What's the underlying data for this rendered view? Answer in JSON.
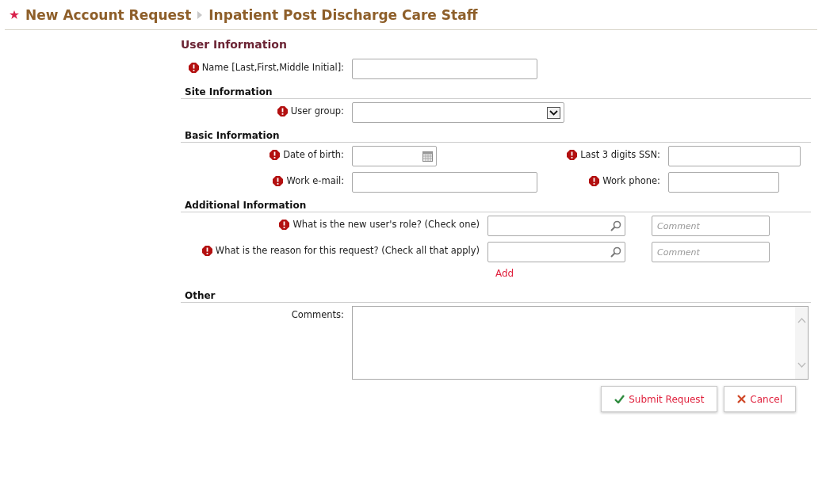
{
  "breadcrumb": [
    "New Account Request",
    "Inpatient Post Discharge Care Staff"
  ],
  "sections": [
    {
      "title": "User Information",
      "kind": "primary",
      "rows": [
        [
          {
            "label": "Name [Last,First,Middle Initial]:",
            "required": true,
            "kind": "text"
          }
        ]
      ]
    },
    {
      "title": "Site Information",
      "kind": "secondary",
      "rows": [
        [
          {
            "label": "User group:",
            "required": true,
            "kind": "select"
          }
        ]
      ]
    },
    {
      "title": "Basic Information",
      "kind": "secondary",
      "rows": [
        [
          {
            "label": "Date of birth:",
            "required": true,
            "kind": "date"
          },
          {
            "label": "Last 3 digits SSN:",
            "required": true,
            "kind": "text"
          }
        ],
        [
          {
            "label": "Work e-mail:",
            "required": true,
            "kind": "text"
          },
          {
            "label": "Work phone:",
            "required": true,
            "kind": "text"
          }
        ]
      ]
    },
    {
      "title": "Additional Information",
      "kind": "secondary",
      "rows": [
        [
          {
            "label": "What is the new user's role? (Check one)",
            "required": true,
            "kind": "lookup",
            "comment_placeholder": "Comment"
          }
        ],
        [
          {
            "label": "What is the reason for this request? (Check all that apply)",
            "required": true,
            "kind": "lookup",
            "comment_placeholder": "Comment"
          }
        ]
      ],
      "link": "Add"
    },
    {
      "title": "Other",
      "kind": "secondary",
      "rows": [
        [
          {
            "label": "Comments:",
            "required": false,
            "kind": "textarea"
          }
        ]
      ]
    }
  ],
  "buttons": [
    {
      "label": "Submit Request",
      "kind": "submit"
    },
    {
      "label": "Cancel",
      "kind": "cancel"
    }
  ]
}
